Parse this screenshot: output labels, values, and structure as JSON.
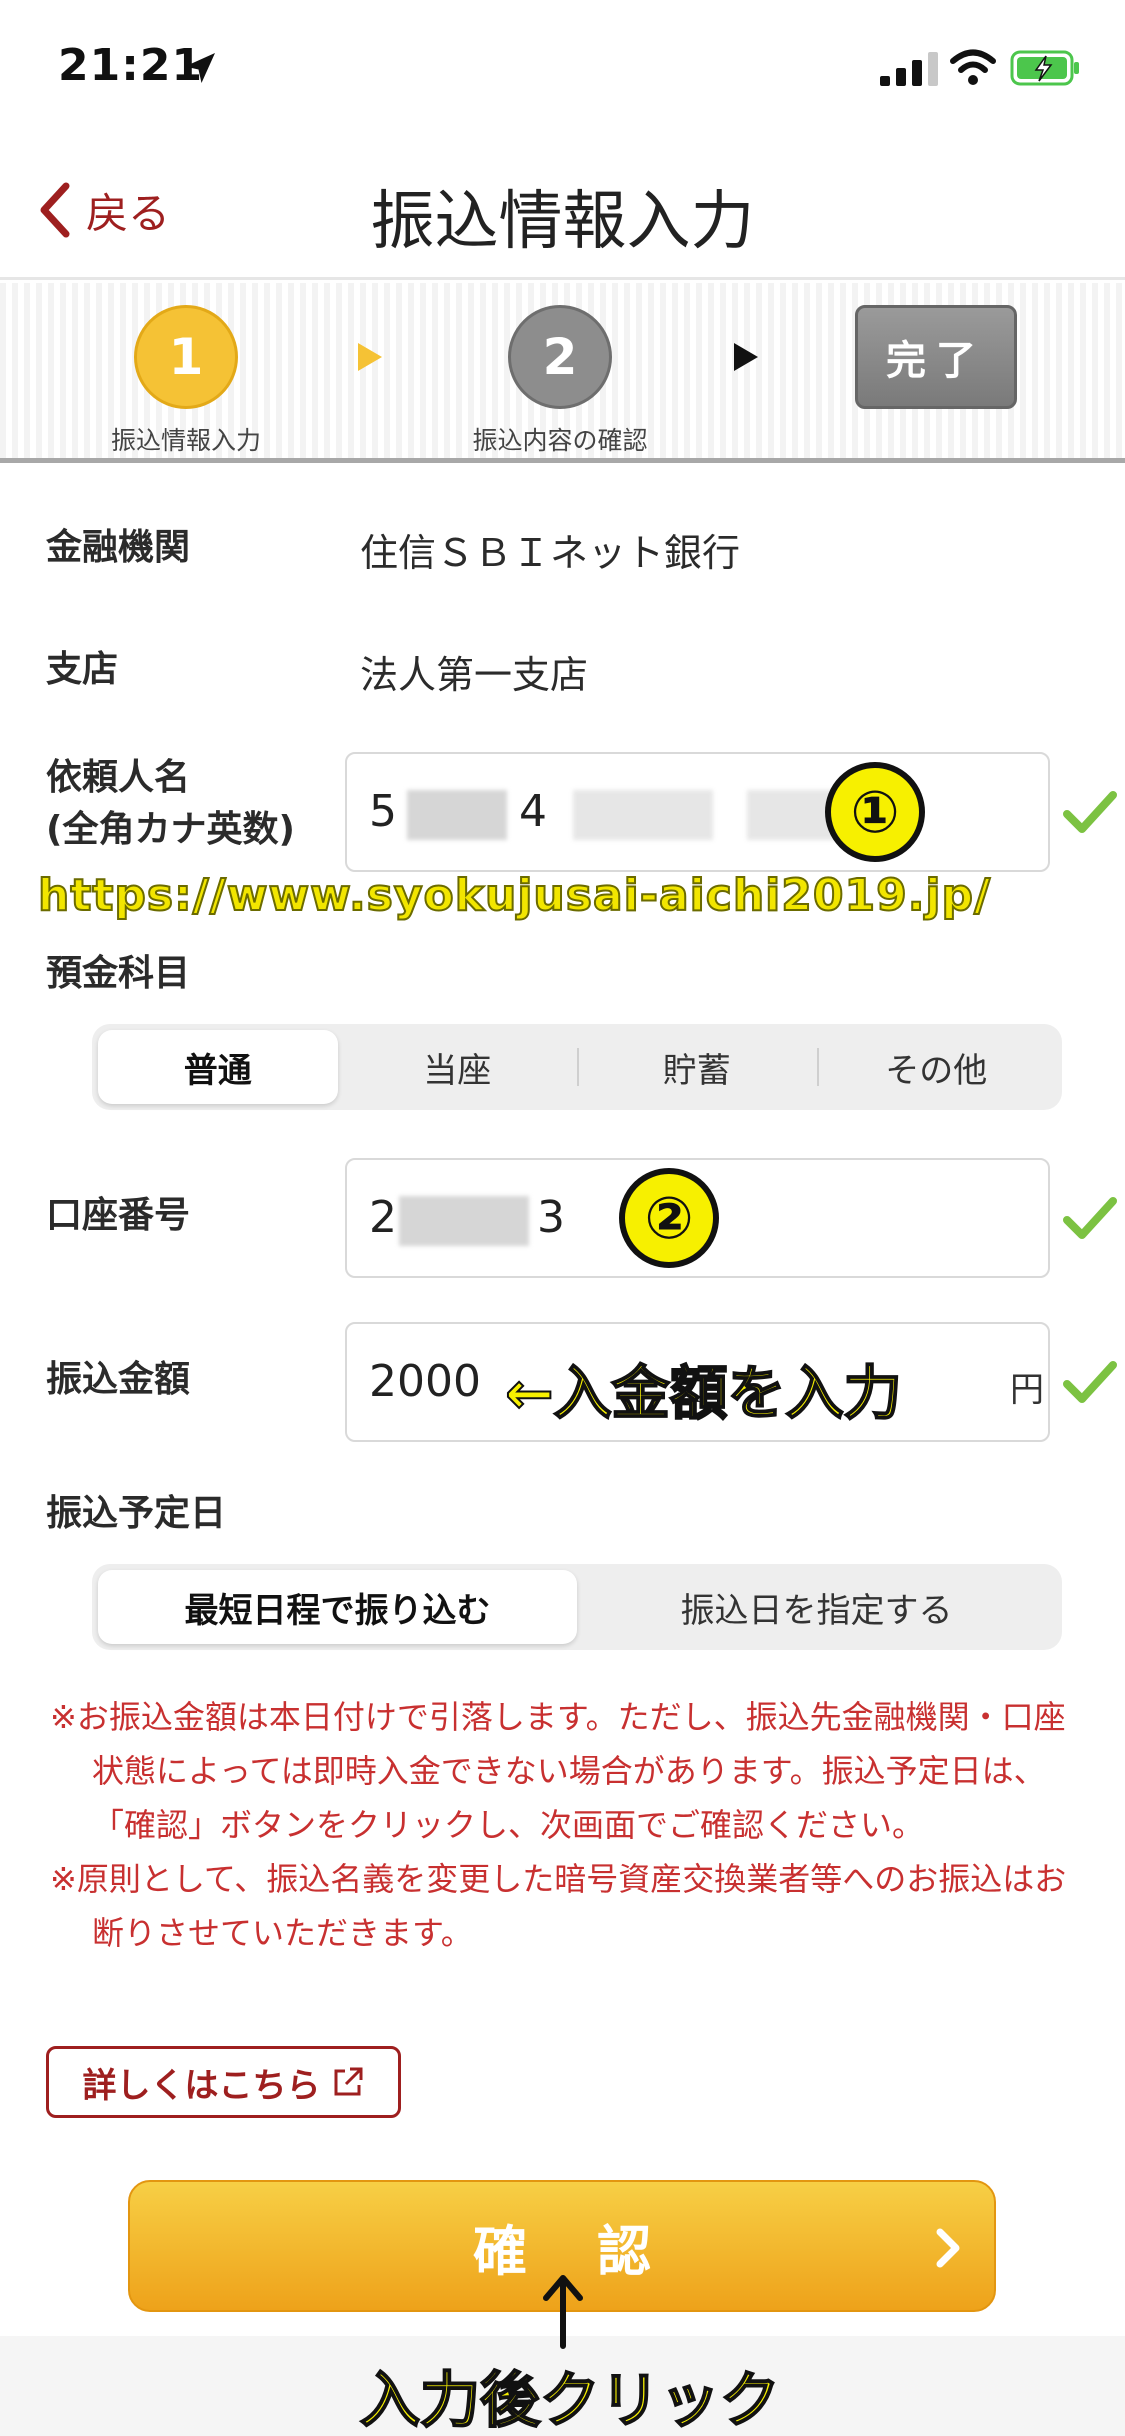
{
  "status_bar": {
    "time": "21:21"
  },
  "nav": {
    "back_label": "戻る",
    "title": "振込情報入力"
  },
  "stepper": {
    "steps": [
      {
        "number": "1",
        "label": "振込情報入力"
      },
      {
        "number": "2",
        "label": "振込内容の確認"
      }
    ],
    "done_label": "完了"
  },
  "form": {
    "bank_label": "金融機関",
    "bank_value": "住信ＳＢＩネット銀行",
    "branch_label": "支店",
    "branch_value": "法人第一支店",
    "requester_label_line1": "依頼人名",
    "requester_label_line2": "(全角カナ英数)",
    "requester_value_a": "5",
    "requester_value_b": "4",
    "deposit_type_label": "預金科目",
    "deposit_types": [
      "普通",
      "当座",
      "貯蓄",
      "その他"
    ],
    "account_label": "口座番号",
    "account_value_a": "2",
    "account_value_b": "3",
    "amount_label": "振込金額",
    "amount_value": "2000",
    "amount_unit": "円",
    "date_label": "振込予定日",
    "date_options": [
      "最短日程で振り込む",
      "振込日を指定する"
    ]
  },
  "notes": [
    "※お振込金額は本日付けで引落します。ただし、振込先金融機関・口座状態によっては即時入金できない場合があります。振込予定日は、「確認」ボタンをクリックし、次画面でご確認ください。",
    "※原則として、振込名義を変更した暗号資産交換業者等へのお振込はお断りさせていただきます。"
  ],
  "detail_button": "詳しくはこちら",
  "confirm_button": "確認",
  "annotations": {
    "marker1": "①",
    "marker2": "②",
    "watermark": "https://www.syokujusai-aichi2019.jp/",
    "amount_hint": "←入金額を入力",
    "click_hint": "入力後クリック"
  },
  "colors": {
    "accent": "#9e1f1f",
    "step_active": "#f5c235",
    "note": "#c83030",
    "check": "#7cc242"
  }
}
